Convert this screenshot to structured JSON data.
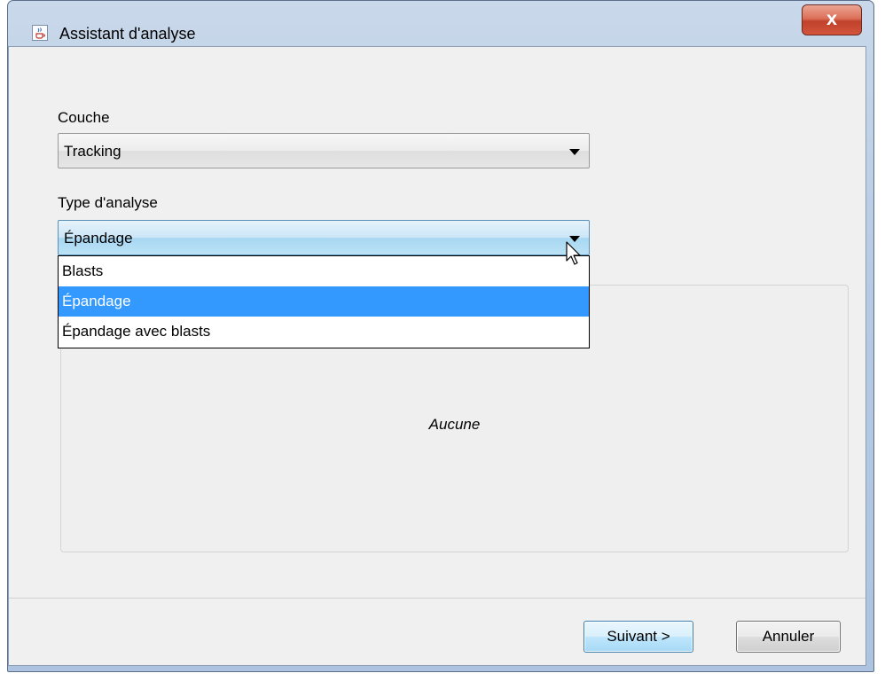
{
  "window": {
    "title": "Assistant d'analyse",
    "close_label": "X"
  },
  "form": {
    "layer_label": "Couche",
    "layer_value": "Tracking",
    "analysis_type_label": "Type d'analyse",
    "analysis_type_value": "Épandage"
  },
  "dropdown": {
    "items": [
      {
        "label": "Blasts",
        "selected": false
      },
      {
        "label": "Épandage",
        "selected": true
      },
      {
        "label": "Épandage avec blasts",
        "selected": false
      }
    ]
  },
  "preview": {
    "text": "Aucune"
  },
  "buttons": {
    "next_label": "Suivant >",
    "cancel_label": "Annuler"
  },
  "colors": {
    "selection": "#3399ff",
    "dialog_bg": "#f0f0f0",
    "close_button": "#c1412a"
  },
  "icons": {
    "app": "java-cup-icon",
    "close": "close-icon",
    "dropdown_arrow": "chevron-down-icon",
    "pointer": "mouse-cursor-icon"
  }
}
